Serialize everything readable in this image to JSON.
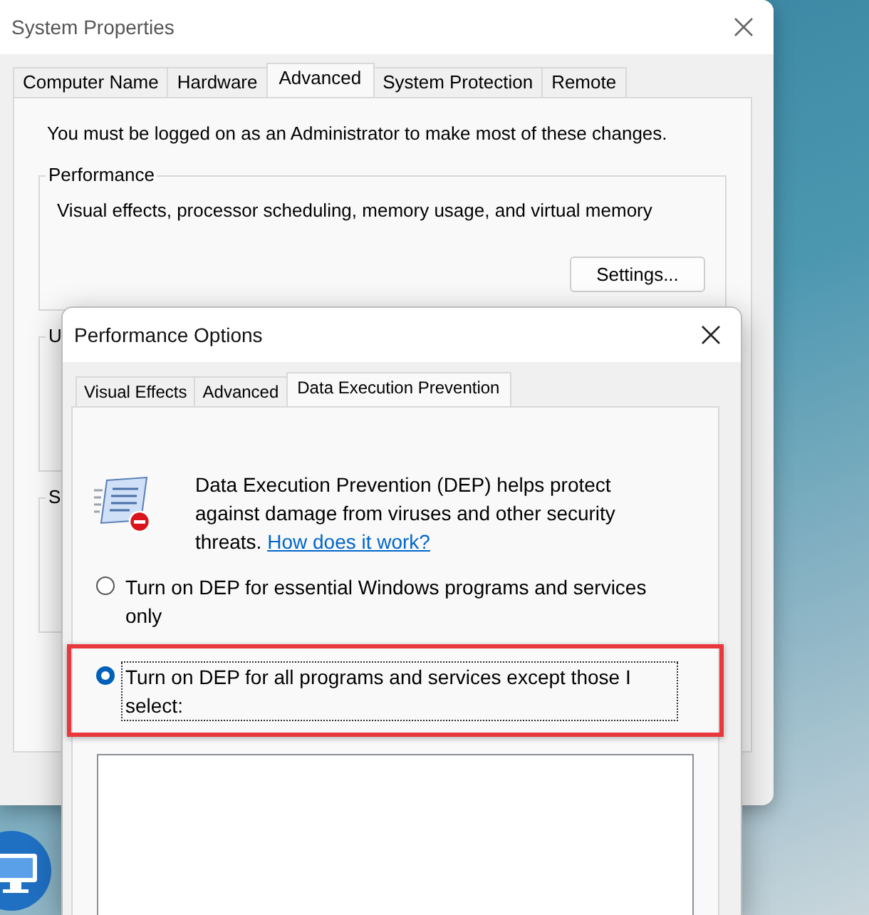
{
  "system_properties": {
    "title": "System Properties",
    "tabs": [
      {
        "label": "Computer Name",
        "selected": false
      },
      {
        "label": "Hardware",
        "selected": false
      },
      {
        "label": "Advanced",
        "selected": true
      },
      {
        "label": "System Protection",
        "selected": false
      },
      {
        "label": "Remote",
        "selected": false
      }
    ],
    "notice": "You must be logged on as an Administrator to make most of these changes.",
    "groups": [
      {
        "label": "Performance",
        "description": "Visual effects, processor scheduling, memory usage, and virtual memory",
        "button": "Settings..."
      },
      {
        "label": "U"
      },
      {
        "label": "S"
      }
    ]
  },
  "performance_options": {
    "title": "Performance Options",
    "tabs": [
      {
        "label": "Visual Effects",
        "selected": false
      },
      {
        "label": "Advanced",
        "selected": false
      },
      {
        "label": "Data Execution Prevention",
        "selected": true
      }
    ],
    "description": "Data Execution Prevention (DEP) helps protect against damage from viruses and other security threats.",
    "link": "How does it work?",
    "options": [
      {
        "label": "Turn on DEP for essential Windows programs and services only",
        "selected": false,
        "focused": false,
        "highlighted": false
      },
      {
        "label": "Turn on DEP for all programs and services except those I select:",
        "selected": true,
        "focused": true,
        "highlighted": true
      }
    ]
  }
}
